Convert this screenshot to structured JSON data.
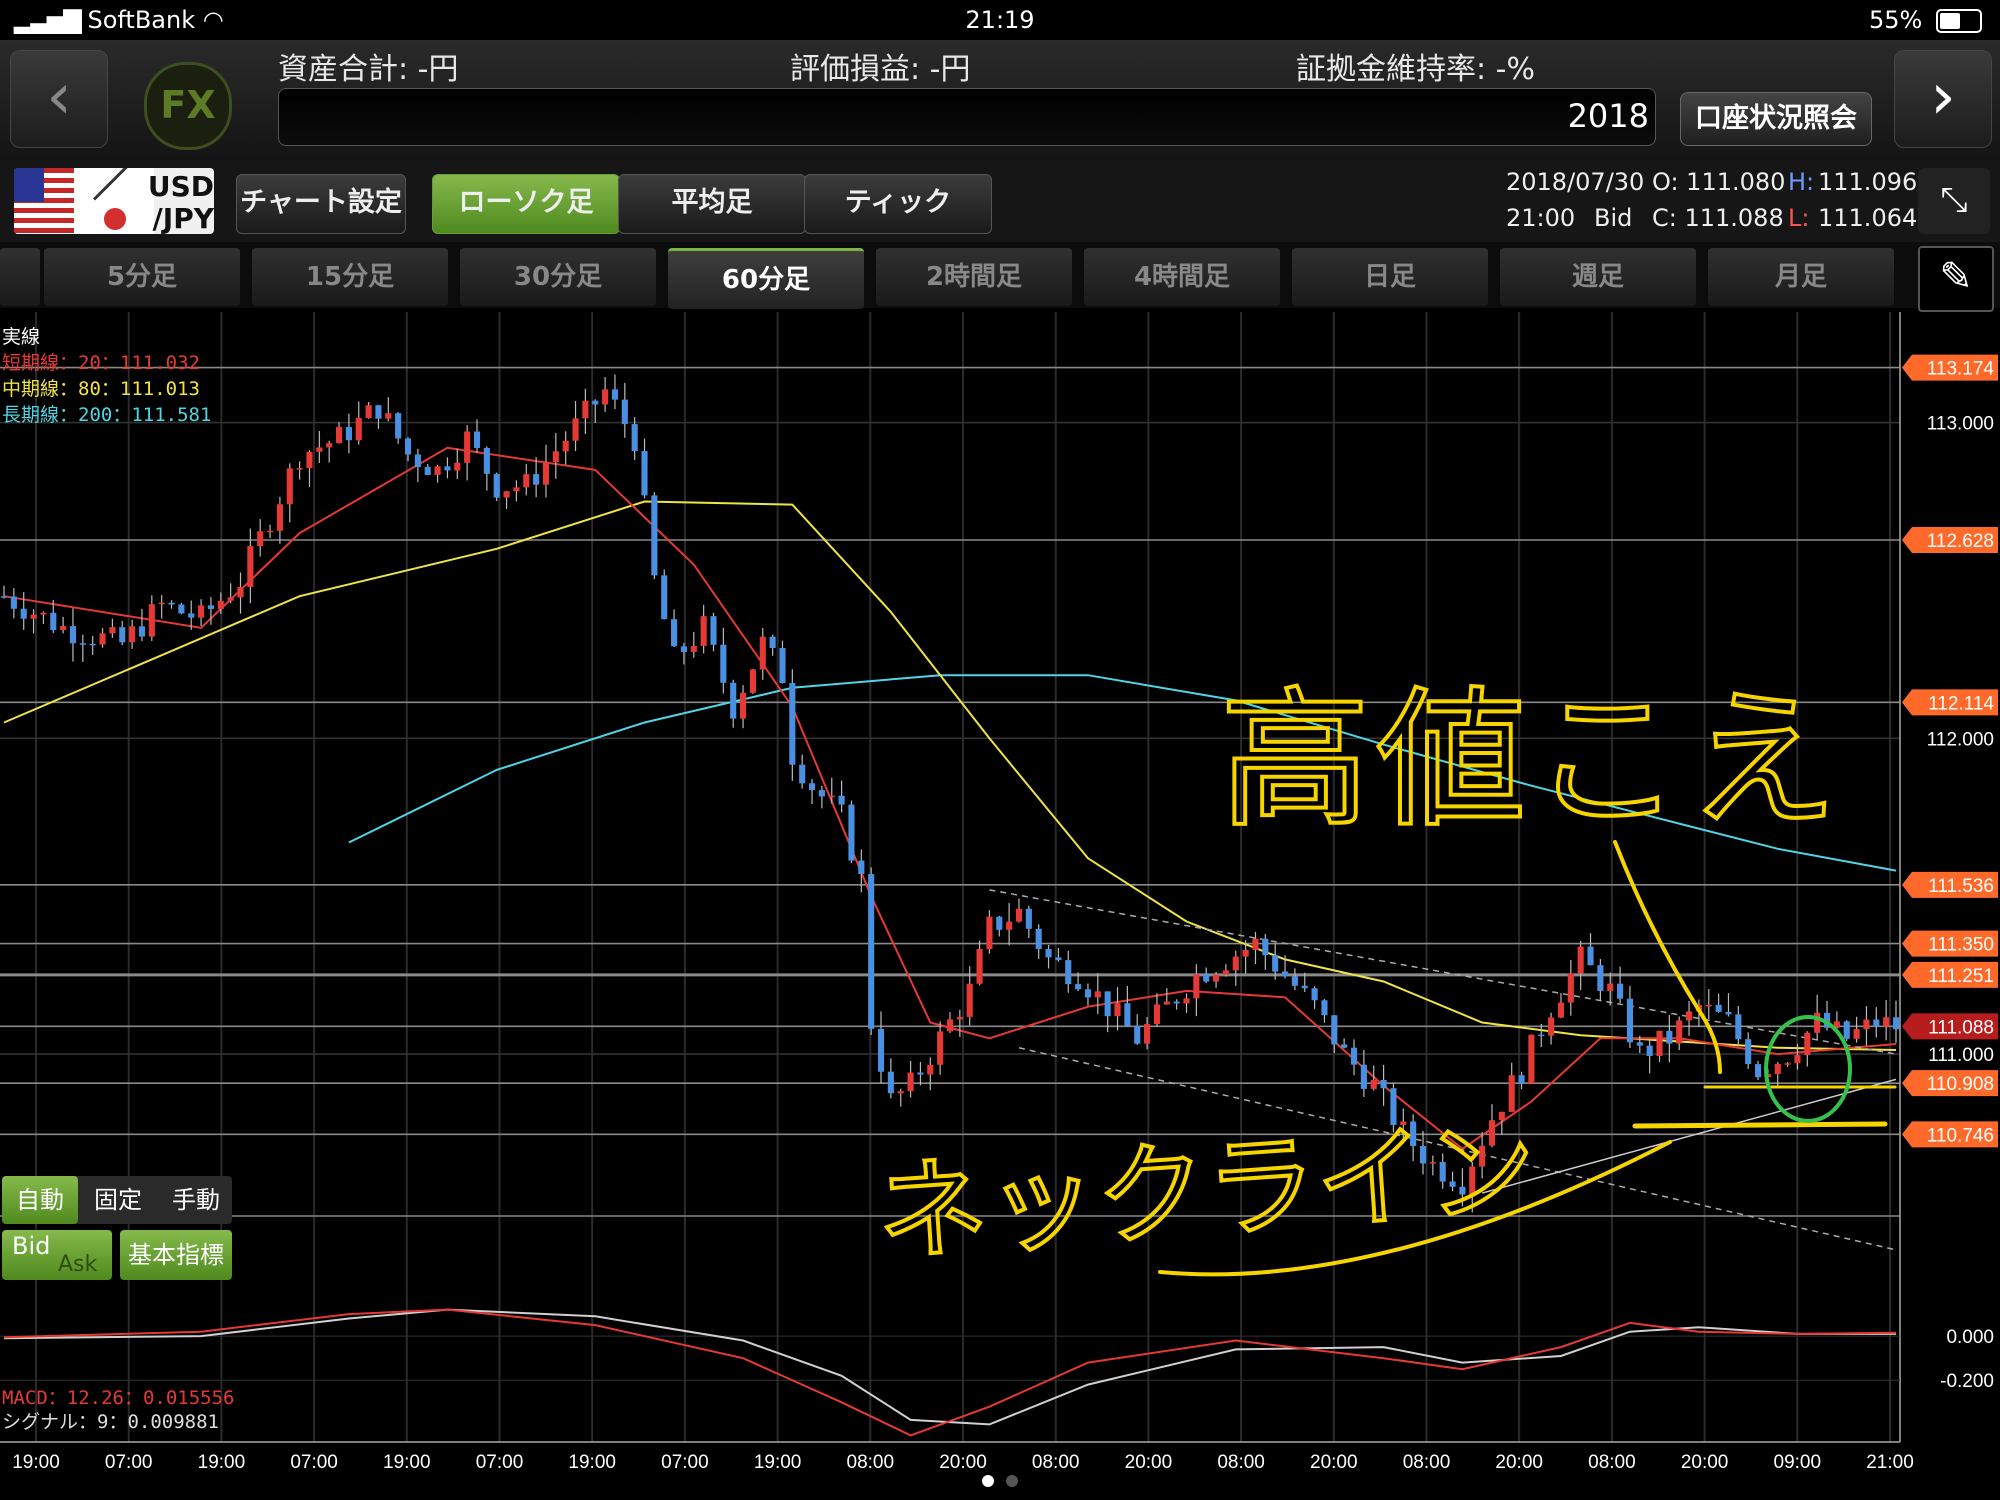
{
  "status_bar": {
    "carrier": "SoftBank",
    "time": "21:19",
    "battery": "55%"
  },
  "header": {
    "total_assets": "資産合計: -円",
    "unrealized_pl": "評価損益: -円",
    "margin_ratio": "証拠金維持率: -%",
    "year": "2018",
    "account_button": "口座状況照会",
    "logo": "FX",
    "back_icon": "chevron-left-icon",
    "forward_icon": "chevron-right-icon"
  },
  "toolbar": {
    "pair_top": "USD",
    "pair_bottom": "/JPY",
    "chart_settings": "チャート設定",
    "chart_types": [
      "ローソク足",
      "平均足",
      "ティック"
    ],
    "selected_chart_type": "ローソク足",
    "date": "2018/07/30",
    "time": "21:00",
    "price_type": "Bid",
    "open": "O: 111.080",
    "high_label": "H:",
    "high": "111.096",
    "close": "C: 111.088",
    "low_label": "L:",
    "low": "111.064",
    "expand_icon": "collapse-arrows-icon"
  },
  "timeframes": {
    "items": [
      "5分足",
      "15分足",
      "30分足",
      "60分足",
      "2時間足",
      "4時間足",
      "日足",
      "週足",
      "月足"
    ],
    "selected": "60分足",
    "draw_icon": "pen-icon"
  },
  "legend": {
    "title": "実線",
    "short": {
      "label": "短期線：20",
      "value": "：111.032",
      "color": "#e53935"
    },
    "mid": {
      "label": "中期線：80",
      "value": "：111.013",
      "color": "#f0e442"
    },
    "long": {
      "label": "長期線：200",
      "value": "：111.581",
      "color": "#4fd5e6"
    }
  },
  "controls": {
    "modes": [
      "自動",
      "固定",
      "手動"
    ],
    "selected_mode": "自動",
    "bid": "Bid",
    "ask": "Ask",
    "indicator": "基本指標"
  },
  "macd": {
    "macd_label": "MACD：12.26",
    "macd_value": "：0.015556",
    "signal_label": "シグナル：9",
    "signal_value": "：0.009881"
  },
  "annotations": {
    "top_text": "高値こえ",
    "bottom_text": "ネックライン"
  },
  "chart_data": {
    "type": "candlestick",
    "symbol": "USD/JPY",
    "ylim": [
      110.5,
      113.35
    ],
    "price_labels": [
      {
        "value": 113.174,
        "text": "113.174",
        "tag": true
      },
      {
        "value": 113.0,
        "text": "113.000",
        "tag": false
      },
      {
        "value": 112.628,
        "text": "112.628",
        "tag": true
      },
      {
        "value": 112.114,
        "text": "112.114",
        "tag": true
      },
      {
        "value": 112.0,
        "text": "112.000",
        "tag": false
      },
      {
        "value": 111.536,
        "text": "111.536",
        "tag": true
      },
      {
        "value": 111.35,
        "text": "111.350",
        "tag": true
      },
      {
        "value": 111.251,
        "text": "111.251",
        "tag": true
      },
      {
        "value": 111.088,
        "text": "111.088",
        "tag": true,
        "current": true
      },
      {
        "value": 111.0,
        "text": "111.000",
        "tag": false
      },
      {
        "value": 110.908,
        "text": "110.908",
        "tag": true
      },
      {
        "value": 110.746,
        "text": "110.746",
        "tag": true
      }
    ],
    "x_ticks": [
      "19:00",
      "07:00",
      "19:00",
      "07:00",
      "19:00",
      "07:00",
      "19:00",
      "07:00",
      "19:00",
      "08:00",
      "20:00",
      "08:00",
      "20:00",
      "08:00",
      "20:00",
      "08:00",
      "20:00",
      "08:00",
      "20:00",
      "09:00",
      "21:00"
    ],
    "close_path": [
      [
        0,
        112.45
      ],
      [
        6,
        112.35
      ],
      [
        12,
        112.3
      ],
      [
        16,
        112.42
      ],
      [
        20,
        112.38
      ],
      [
        24,
        112.5
      ],
      [
        27,
        112.7
      ],
      [
        30,
        112.9
      ],
      [
        34,
        112.95
      ],
      [
        38,
        113.05
      ],
      [
        41,
        112.9
      ],
      [
        44,
        112.85
      ],
      [
        47,
        112.95
      ],
      [
        50,
        112.8
      ],
      [
        53,
        112.8
      ],
      [
        57,
        112.95
      ],
      [
        61,
        113.1
      ],
      [
        64,
        112.95
      ],
      [
        66,
        112.5
      ],
      [
        68,
        112.25
      ],
      [
        71,
        112.35
      ],
      [
        74,
        112.1
      ],
      [
        77,
        112.3
      ],
      [
        79,
        112.2
      ],
      [
        80,
        111.95
      ],
      [
        82,
        111.85
      ],
      [
        85,
        111.75
      ],
      [
        87,
        111.55
      ],
      [
        88,
        111.1
      ],
      [
        90,
        110.85
      ],
      [
        92,
        110.9
      ],
      [
        95,
        111.05
      ],
      [
        98,
        111.2
      ],
      [
        100,
        111.4
      ],
      [
        103,
        111.45
      ],
      [
        106,
        111.3
      ],
      [
        109,
        111.25
      ],
      [
        112,
        111.15
      ],
      [
        115,
        111.05
      ],
      [
        118,
        111.15
      ],
      [
        121,
        111.25
      ],
      [
        124,
        111.3
      ],
      [
        127,
        111.35
      ],
      [
        130,
        111.25
      ],
      [
        133,
        111.15
      ],
      [
        136,
        111.0
      ],
      [
        139,
        110.9
      ],
      [
        142,
        110.75
      ],
      [
        145,
        110.65
      ],
      [
        148,
        110.6
      ],
      [
        151,
        110.8
      ],
      [
        154,
        110.95
      ],
      [
        157,
        111.15
      ],
      [
        160,
        111.3
      ],
      [
        163,
        111.2
      ],
      [
        166,
        111.0
      ],
      [
        169,
        111.05
      ],
      [
        172,
        111.15
      ],
      [
        175,
        111.1
      ],
      [
        178,
        110.95
      ],
      [
        181,
        111.0
      ],
      [
        184,
        111.1
      ],
      [
        187,
        111.05
      ],
      [
        190,
        111.1
      ],
      [
        192,
        111.088
      ]
    ],
    "n_candles": 193,
    "ma_short": [
      [
        0,
        112.45
      ],
      [
        20,
        112.35
      ],
      [
        30,
        112.65
      ],
      [
        45,
        112.92
      ],
      [
        60,
        112.85
      ],
      [
        70,
        112.55
      ],
      [
        80,
        112.1
      ],
      [
        88,
        111.5
      ],
      [
        94,
        111.1
      ],
      [
        100,
        111.05
      ],
      [
        110,
        111.15
      ],
      [
        120,
        111.2
      ],
      [
        130,
        111.18
      ],
      [
        140,
        110.9
      ],
      [
        148,
        110.7
      ],
      [
        155,
        110.85
      ],
      [
        162,
        111.05
      ],
      [
        170,
        111.05
      ],
      [
        180,
        111.0
      ],
      [
        192,
        111.032
      ]
    ],
    "ma_mid": [
      [
        0,
        112.05
      ],
      [
        15,
        112.25
      ],
      [
        30,
        112.45
      ],
      [
        50,
        112.6
      ],
      [
        65,
        112.75
      ],
      [
        80,
        112.74
      ],
      [
        90,
        112.4
      ],
      [
        100,
        112.0
      ],
      [
        110,
        111.62
      ],
      [
        120,
        111.42
      ],
      [
        130,
        111.3
      ],
      [
        140,
        111.23
      ],
      [
        150,
        111.1
      ],
      [
        160,
        111.06
      ],
      [
        170,
        111.04
      ],
      [
        180,
        111.02
      ],
      [
        192,
        111.013
      ]
    ],
    "ma_long": [
      [
        35,
        111.67
      ],
      [
        50,
        111.9
      ],
      [
        65,
        112.05
      ],
      [
        80,
        112.16
      ],
      [
        95,
        112.2
      ],
      [
        110,
        112.2
      ],
      [
        125,
        112.12
      ],
      [
        140,
        111.98
      ],
      [
        155,
        111.85
      ],
      [
        170,
        111.73
      ],
      [
        180,
        111.65
      ],
      [
        192,
        111.581
      ]
    ],
    "macd_line": [
      [
        0,
        -0.005
      ],
      [
        20,
        0.02
      ],
      [
        35,
        0.1
      ],
      [
        45,
        0.12
      ],
      [
        60,
        0.05
      ],
      [
        75,
        -0.1
      ],
      [
        85,
        -0.3
      ],
      [
        92,
        -0.45
      ],
      [
        100,
        -0.32
      ],
      [
        110,
        -0.12
      ],
      [
        125,
        -0.02
      ],
      [
        140,
        -0.1
      ],
      [
        148,
        -0.15
      ],
      [
        158,
        -0.05
      ],
      [
        165,
        0.06
      ],
      [
        172,
        0.02
      ],
      [
        182,
        0.01
      ],
      [
        192,
        0.015556
      ]
    ],
    "macd_signal": [
      [
        0,
        -0.01
      ],
      [
        20,
        0.0
      ],
      [
        35,
        0.08
      ],
      [
        45,
        0.12
      ],
      [
        60,
        0.09
      ],
      [
        75,
        -0.02
      ],
      [
        85,
        -0.18
      ],
      [
        92,
        -0.38
      ],
      [
        100,
        -0.4
      ],
      [
        110,
        -0.22
      ],
      [
        125,
        -0.06
      ],
      [
        140,
        -0.05
      ],
      [
        148,
        -0.12
      ],
      [
        158,
        -0.09
      ],
      [
        165,
        0.02
      ],
      [
        172,
        0.04
      ],
      [
        182,
        0.01
      ],
      [
        192,
        0.009881
      ]
    ],
    "macd_ylim": [
      -0.48,
      0.2
    ],
    "macd_ticks": [
      {
        "value": 0.0,
        "text": "0.000"
      },
      {
        "value": -0.2,
        "text": "-0.200"
      }
    ],
    "colors": {
      "up": "#e53935",
      "down": "#4a90e2",
      "short": "#e53935",
      "mid": "#f0e442",
      "long": "#4fd5e6",
      "macd": "#e53935",
      "signal": "#d0d0d0",
      "annotation": "#f5d400",
      "tag": "#ff6a2b"
    }
  }
}
